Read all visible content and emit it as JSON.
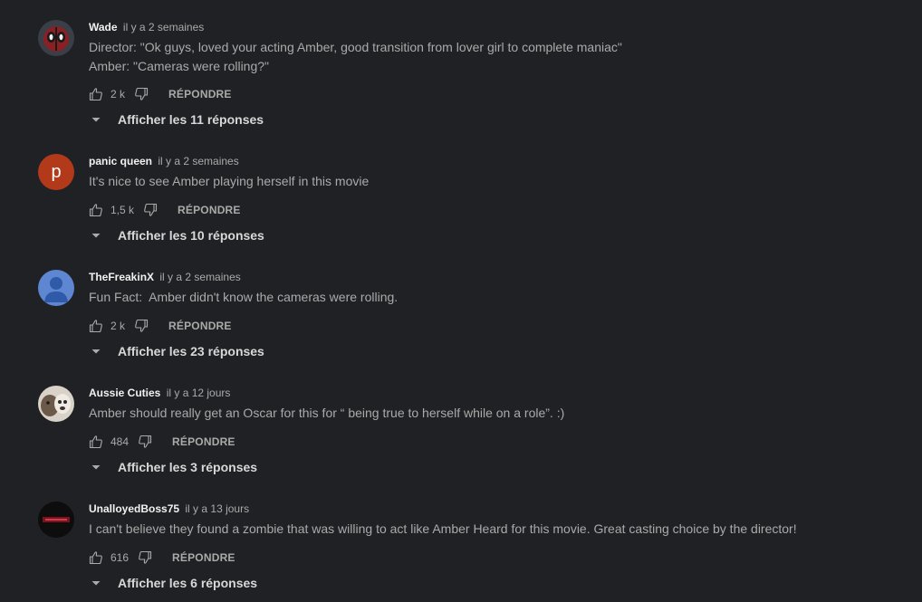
{
  "comments": [
    {
      "author": "Wade",
      "time": "il y a 2 semaines",
      "text_lines": [
        "Director: \"Ok guys, loved your acting Amber, good transition from lover girl to complete maniac\"",
        "Amber: \"Cameras were rolling?\""
      ],
      "likes": "2 k",
      "reply_label": "RÉPONDRE",
      "replies_label": "Afficher les 11 réponses",
      "avatar": "deadpool-avatar"
    },
    {
      "author": "panic queen",
      "time": "il y a 2 semaines",
      "text_lines": [
        "It's nice to see Amber playing herself in this movie"
      ],
      "likes": "1,5 k",
      "reply_label": "RÉPONDRE",
      "replies_label": "Afficher les 10 réponses",
      "avatar": "letter-avatar",
      "avatar_letter": "p",
      "avatar_color": "#b23a1a"
    },
    {
      "author": "TheFreakinX",
      "time": "il y a 2 semaines",
      "text_lines": [
        "Fun Fact:  Amber didn't know the cameras were rolling."
      ],
      "likes": "2 k",
      "reply_label": "RÉPONDRE",
      "replies_label": "Afficher les 23 réponses",
      "avatar": "default-person-avatar",
      "avatar_color": "#5e86d1"
    },
    {
      "author": "Aussie Cuties",
      "time": "il y a 12 jours",
      "text_lines": [
        "Amber should really get an Oscar for this for “ being true to herself while on a role”. :)"
      ],
      "likes": "484",
      "reply_label": "RÉPONDRE",
      "replies_label": "Afficher les 3 réponses",
      "avatar": "dog-photo-avatar"
    },
    {
      "author": "UnalloyedBoss75",
      "time": "il y a 13 jours",
      "text_lines": [
        "I can't believe they found a zombie that was willing to act like Amber Heard for this movie. Great casting choice by the director!"
      ],
      "likes": "616",
      "reply_label": "RÉPONDRE",
      "replies_label": "Afficher les 6 réponses",
      "avatar": "dark-logo-avatar"
    }
  ],
  "colors": {
    "background": "#202124",
    "author": "#f1f1f1",
    "secondary_text": "#aaaaaa"
  },
  "icons": {
    "like": "thumb-up-icon",
    "dislike": "thumb-down-icon",
    "replies": "caret-down-icon"
  }
}
